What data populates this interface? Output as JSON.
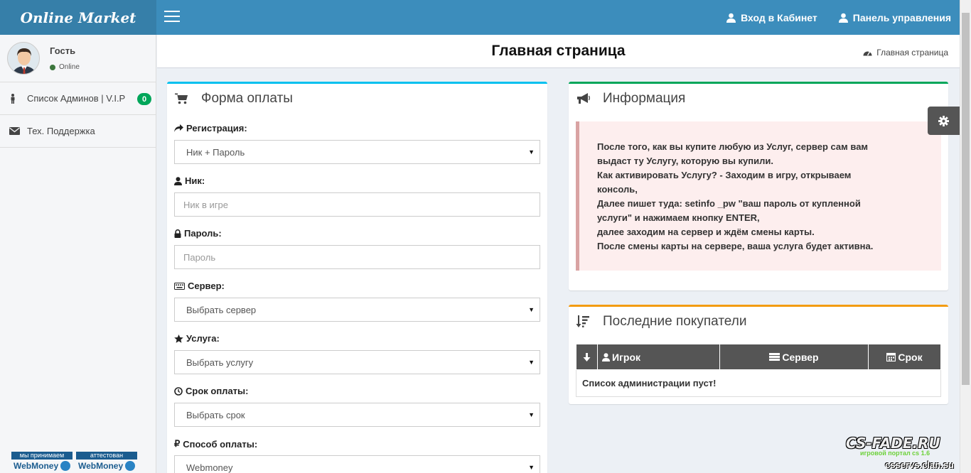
{
  "app": {
    "logo": "Online Market"
  },
  "topnav": {
    "cabinet": "Вход в Кабинет",
    "panel": "Панель управления"
  },
  "sidebar": {
    "user": {
      "name": "Гость",
      "status": "Online"
    },
    "items": [
      {
        "label": "Список Админов | V.I.P",
        "badge": "0"
      },
      {
        "label": "Тех. Поддержка"
      }
    ],
    "webmoney": [
      {
        "top": "мы принимаем",
        "bottom": "WebMoney"
      },
      {
        "top": "аттестован",
        "bottom": "WebMoney"
      }
    ]
  },
  "header": {
    "title": "Главная страница",
    "breadcrumb": "Главная страница"
  },
  "payment": {
    "title": "Форма оплаты",
    "fields": [
      {
        "label": "Регистрация:",
        "value": "Ник + Пароль"
      },
      {
        "label": "Ник:",
        "placeholder": "Ник в игре"
      },
      {
        "label": "Пароль:",
        "placeholder": "Пароль"
      },
      {
        "label": "Сервер:",
        "value": "Выбрать сервер"
      },
      {
        "label": "Услуга:",
        "value": "Выбрать услугу"
      },
      {
        "label": "Срок оплаты:",
        "value": "Выбрать срок"
      },
      {
        "label": "Способ оплаты:",
        "value": "Webmoney"
      }
    ]
  },
  "info": {
    "title": "Информация",
    "lines": [
      "После того, как вы купите любую из Услуг, сервер сам вам",
      "выдаст ту Услугу, которую вы купили.",
      "Как активировать Услугу? - Заходим в игру, открываем",
      "консоль,",
      "Далее пишет туда: setinfo _pw \"ваш пароль от купленной",
      "услуги\" и нажимаем кнопку ENTER,",
      "далее заходим на сервер и ждём смены карты.",
      "После смены карты на сервере, ваша услуга будет активна."
    ]
  },
  "buyers": {
    "title": "Последние покупатели",
    "columns": [
      "Игрок",
      "Сервер",
      "Срок"
    ],
    "empty": "Список администрации пуст!"
  },
  "watermark": {
    "site": "CS-FADE.RU",
    "tag": "игровой портал cs 1.6",
    "url": "csservs.clan.su"
  },
  "colors": {
    "topbar": "#3c8dbc",
    "logo_bg": "#367fa9",
    "info_accent": "#00a65a",
    "pay_accent": "#00c0ef",
    "buyers_accent": "#f39c12"
  }
}
